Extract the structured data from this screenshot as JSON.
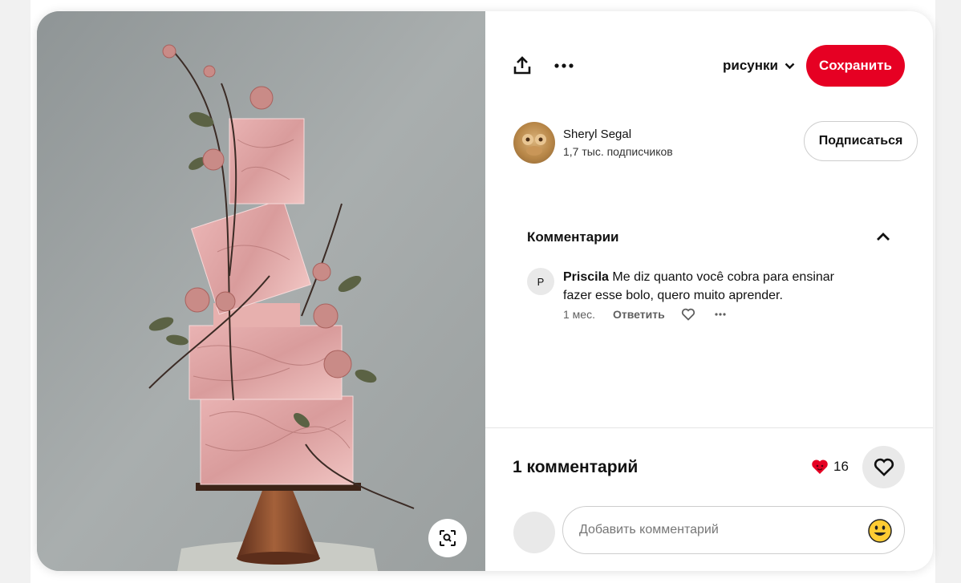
{
  "toolbar": {
    "share_icon": "share-upload-icon",
    "more_icon": "ellipsis-icon",
    "board_name": "рисунки",
    "save_label": "Сохранить"
  },
  "author": {
    "name": "Sheryl Segal",
    "followers": "1,7 тыс. подписчиков",
    "follow_label": "Подписаться"
  },
  "comments": {
    "title": "Комментарии",
    "items": [
      {
        "initial": "P",
        "user": "Priscila",
        "text": "Me diz quanto você cobra para ensinar fazer esse bolo, quero muito aprender.",
        "time": "1 мес.",
        "reply_label": "Ответить"
      }
    ]
  },
  "footer": {
    "count_label": "1 комментарий",
    "reactions": "16",
    "input_placeholder": "Добавить комментарий"
  },
  "colors": {
    "save_button": "#e60023",
    "accent_heart": "#e60023"
  }
}
